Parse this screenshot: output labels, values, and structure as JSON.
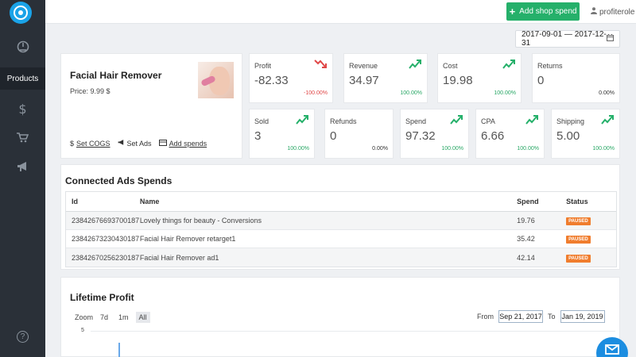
{
  "sidebar": {
    "items": [
      {
        "icon": "dashboard-icon"
      },
      {
        "label": "Products"
      },
      {
        "icon": "dollar-icon",
        "glyph": "$"
      },
      {
        "icon": "cart-icon"
      },
      {
        "icon": "megaphone-icon"
      },
      {
        "icon": "help-icon",
        "glyph": "?"
      }
    ]
  },
  "header": {
    "add_spend_label": "Add shop spend",
    "user_name": "profiterole"
  },
  "date_range": "2017-09-01 — 2017-12-31",
  "product": {
    "name": "Facial Hair Remover",
    "price": "Price: 9.99 $",
    "actions": {
      "set_cogs": "Set COGS",
      "set_ads": "Set Ads",
      "add_spends": "Add spends"
    }
  },
  "stats": [
    {
      "label": "Profit",
      "value": "-82.33",
      "pct": "-100.00%",
      "trend": "down"
    },
    {
      "label": "Revenue",
      "value": "34.97",
      "pct": "100.00%",
      "trend": "up"
    },
    {
      "label": "Cost",
      "value": "19.98",
      "pct": "100.00%",
      "trend": "up"
    },
    {
      "label": "Returns",
      "value": "0",
      "pct": "0.00%",
      "trend": "none"
    },
    {
      "label": "Sold",
      "value": "3",
      "pct": "100.00%",
      "trend": "up"
    },
    {
      "label": "Refunds",
      "value": "0",
      "pct": "0.00%",
      "trend": "none"
    },
    {
      "label": "Spend",
      "value": "97.32",
      "pct": "100.00%",
      "trend": "up"
    },
    {
      "label": "CPA",
      "value": "6.66",
      "pct": "100.00%",
      "trend": "up"
    },
    {
      "label": "Shipping",
      "value": "5.00",
      "pct": "100.00%",
      "trend": "up"
    }
  ],
  "ads": {
    "title": "Connected Ads Spends",
    "columns": {
      "id": "Id",
      "name": "Name",
      "spend": "Spend",
      "status": "Status"
    },
    "rows": [
      {
        "id": "23842676693700187",
        "name": "Lovely things for beauty - Conversions",
        "spend": "19.76",
        "status": "PAUSED"
      },
      {
        "id": "23842673230430187",
        "name": "Facial Hair Remover retarget1",
        "spend": "35.42",
        "status": "PAUSED"
      },
      {
        "id": "23842670256230187",
        "name": "Facial Hair Remover ad1",
        "spend": "42.14",
        "status": "PAUSED"
      }
    ]
  },
  "lifetime": {
    "title": "Lifetime Profit",
    "zoom_label": "Zoom",
    "zoom_options": [
      "7d",
      "1m",
      "All"
    ],
    "zoom_selected": "All",
    "from_label": "From",
    "from_value": "Sep 21, 2017",
    "to_label": "To",
    "to_value": "Jan 19, 2019",
    "y_tick": "5"
  },
  "colors": {
    "sidebar": "#2a3038",
    "primary_green": "#25b06a",
    "negative": "#e04848",
    "badge": "#f07d2e",
    "chat": "#1c8de0"
  }
}
